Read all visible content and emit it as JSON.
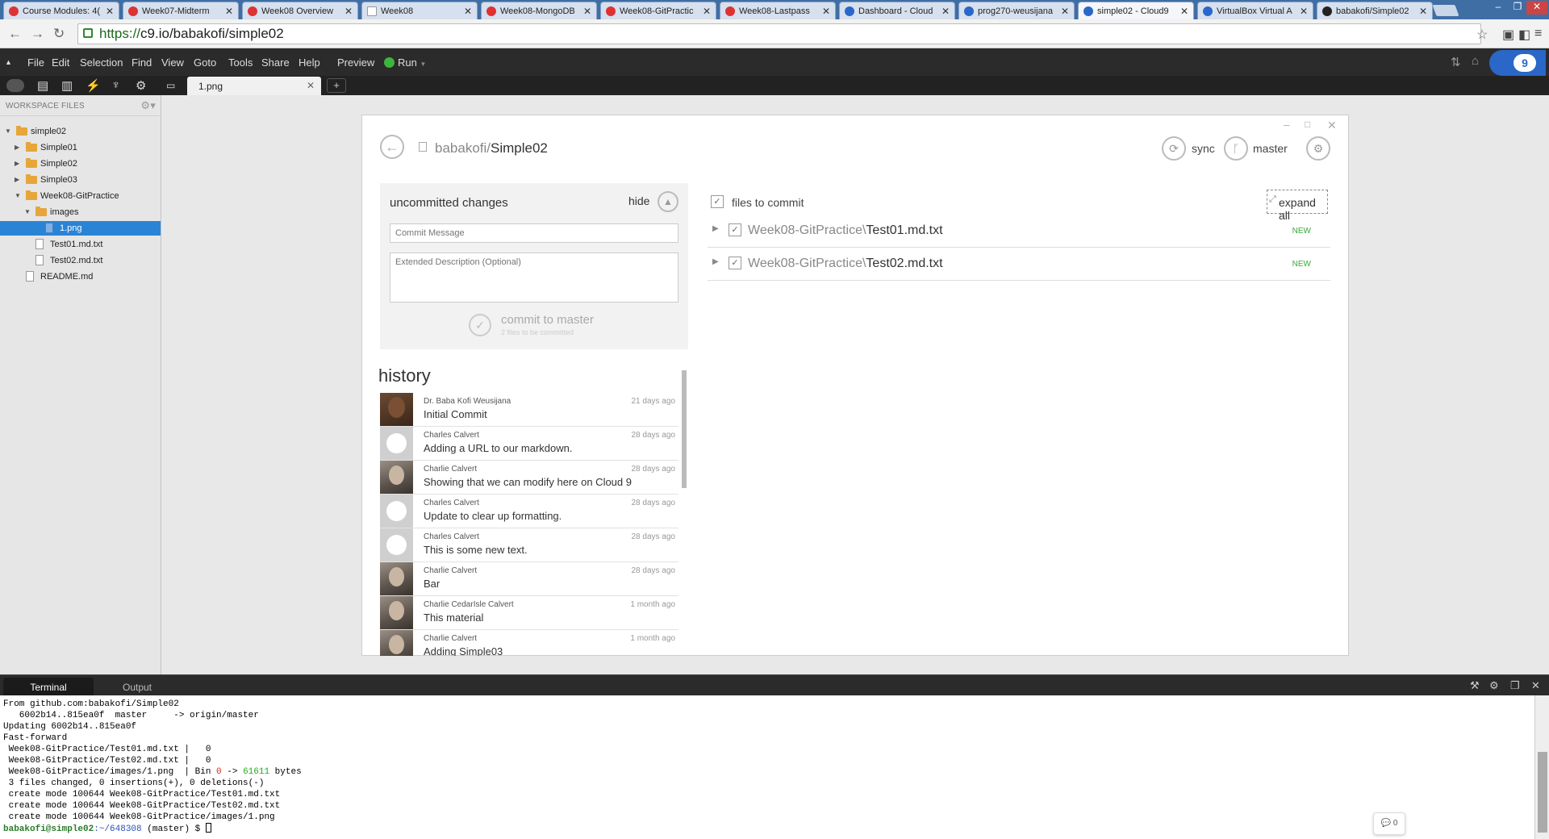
{
  "browser": {
    "tabs": [
      {
        "title": "Course Modules: 4(",
        "icon_color": "#d33"
      },
      {
        "title": "Week07-Midterm",
        "icon_color": "#d33"
      },
      {
        "title": "Week08 Overview",
        "icon_color": "#d33"
      },
      {
        "title": "Week08",
        "icon_color": "#ffffff"
      },
      {
        "title": "Week08-MongoDB",
        "icon_color": "#d33"
      },
      {
        "title": "Week08-GitPractic",
        "icon_color": "#d33"
      },
      {
        "title": "Week08-Lastpass",
        "icon_color": "#d33"
      },
      {
        "title": "Dashboard - Cloud",
        "icon_color": "#2a67c9"
      },
      {
        "title": "prog270-weusijana",
        "icon_color": "#2a67c9"
      },
      {
        "title": "simple02 - Cloud9",
        "icon_color": "#2a67c9"
      },
      {
        "title": "VirtualBox Virtual A",
        "icon_color": "#2a67c9"
      },
      {
        "title": "babakofi/Simple02",
        "icon_color": "#222222"
      }
    ],
    "url_scheme": "https://",
    "url_host": "c9.io/babakofi/simple02"
  },
  "menubar": {
    "items": [
      "File",
      "Edit",
      "Selection",
      "Find",
      "View",
      "Goto",
      "Tools",
      "Share",
      "Help"
    ],
    "preview": "Preview",
    "run": "Run"
  },
  "editor": {
    "tab_title": "1.png"
  },
  "sidebar": {
    "header": "WORKSPACE FILES",
    "tree": [
      {
        "label": "simple02",
        "type": "folder"
      },
      {
        "label": "Simple01",
        "type": "folder"
      },
      {
        "label": "Simple02",
        "type": "folder"
      },
      {
        "label": "Simple03",
        "type": "folder"
      },
      {
        "label": "Week08-GitPractice",
        "type": "folder"
      },
      {
        "label": "images",
        "type": "folder"
      },
      {
        "label": "1.png",
        "type": "image"
      },
      {
        "label": "Test01.md.txt",
        "type": "file"
      },
      {
        "label": "Test02.md.txt",
        "type": "file"
      },
      {
        "label": "README.md",
        "type": "file"
      }
    ]
  },
  "git_panel": {
    "repo_owner": "babakofi/",
    "repo_name": "Simple02",
    "sync": "sync",
    "branch": "master",
    "uncommitted_title": "uncommitted changes",
    "hide": "hide",
    "commit_message_placeholder": "Commit Message",
    "extended_description_placeholder": "Extended Description (Optional)",
    "commit_button": "commit to master",
    "commit_sub": "2 files to be committed",
    "history_title": "history",
    "history": [
      {
        "author": "Dr. Baba Kofi Weusijana",
        "date": "21 days ago",
        "message": "Initial Commit",
        "avatar": "photo2"
      },
      {
        "author": "Charles Calvert",
        "date": "28 days ago",
        "message": "Adding a URL to our markdown.",
        "avatar": "github"
      },
      {
        "author": "Charlie Calvert",
        "date": "28 days ago",
        "message": "Showing that we can modify here on Cloud 9",
        "avatar": "photo"
      },
      {
        "author": "Charles Calvert",
        "date": "28 days ago",
        "message": "Update to clear up formatting.",
        "avatar": "github"
      },
      {
        "author": "Charles Calvert",
        "date": "28 days ago",
        "message": "This is some new text.",
        "avatar": "github"
      },
      {
        "author": "Charlie Calvert",
        "date": "28 days ago",
        "message": "Bar",
        "avatar": "photo"
      },
      {
        "author": "Charlie CedarIsle Calvert",
        "date": "1 month ago",
        "message": "This material",
        "avatar": "photo"
      },
      {
        "author": "Charlie Calvert",
        "date": "1 month ago",
        "message": "Adding Simple03",
        "avatar": "photo"
      }
    ],
    "files_to_commit_label": "files to commit",
    "expand_all": "expand all",
    "files": [
      {
        "dir": "Week08-GitPractice\\",
        "name": "Test01.md.txt",
        "status": "NEW"
      },
      {
        "dir": "Week08-GitPractice\\",
        "name": "Test02.md.txt",
        "status": "NEW"
      }
    ]
  },
  "bottom_panel": {
    "tabs": [
      "Terminal",
      "Output"
    ],
    "chat_count": "0"
  },
  "terminal": {
    "lines": [
      "From github.com:babakofi/Simple02",
      "   6002b14..815ea0f  master     -> origin/master",
      "Updating 6002b14..815ea0f",
      "Fast-forward",
      " Week08-GitPractice/Test01.md.txt |   0",
      " Week08-GitPractice/Test02.md.txt |   0",
      " Week08-GitPractice/images/1.png  | Bin ",
      " 3 files changed, 0 insertions(+), 0 deletions(-)",
      " create mode 100644 Week08-GitPractice/Test01.md.txt",
      " create mode 100644 Week08-GitPractice/Test02.md.txt",
      " create mode 100644 Week08-GitPractice/images/1.png"
    ],
    "bin_from": "0",
    "bin_arrow": " -> ",
    "bin_to": "61611",
    "bin_unit": " bytes",
    "prompt_user": "babakofi@simple02",
    "prompt_path": ":~/648308",
    "prompt_branch": " (master) $ "
  }
}
